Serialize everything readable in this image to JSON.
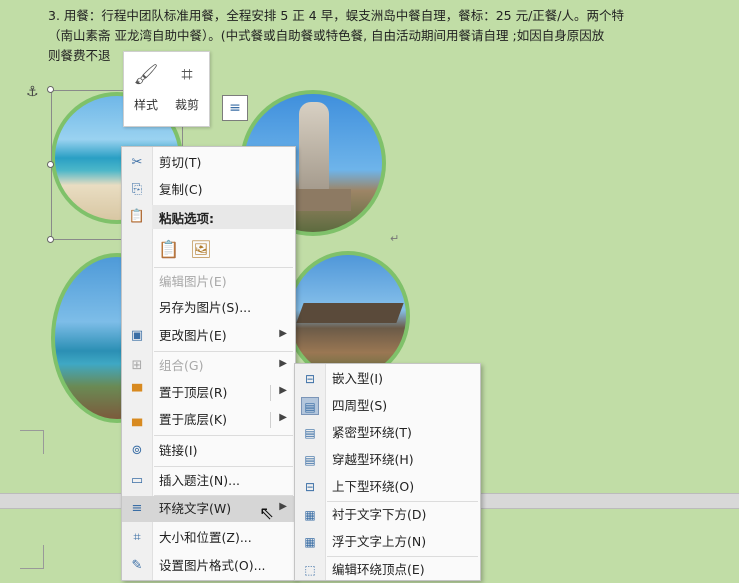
{
  "document": {
    "lines": [
      "3. 用餐：行程中团队标准用餐，全程安排 5 正 4 早，蜈支洲岛中餐自理，餐标：25 元/正餐/人。两个特",
      "（南山素斋 亚龙湾自助中餐）。(中式餐或自助餐或特色餐, 自由活动期间用餐请自理 ;如因自身原因放",
      "则餐费不退"
    ],
    "anchor_symbol": "⚓",
    "para_mark": "↵"
  },
  "mini_toolbar": {
    "style_label": "样式",
    "crop_label": "裁剪"
  },
  "context_menu": {
    "items": [
      {
        "label": "剪切(T)",
        "icon": "scissors-icon"
      },
      {
        "label": "复制(C)",
        "icon": "copy-icon"
      },
      {
        "label": "粘贴选项:",
        "icon": "paste-icon"
      },
      {
        "label": "编辑图片(E)",
        "icon": "",
        "disabled": true
      },
      {
        "label": "另存为图片(S)...",
        "icon": ""
      },
      {
        "label": "更改图片(E)",
        "icon": "change-picture-icon",
        "submenu": true
      },
      {
        "label": "组合(G)",
        "icon": "group-icon",
        "disabled": true,
        "submenu": true
      },
      {
        "label": "置于顶层(R)",
        "icon": "bring-to-front-icon",
        "submenu": true
      },
      {
        "label": "置于底层(K)",
        "icon": "send-to-back-icon",
        "submenu": true
      },
      {
        "label": "链接(I)",
        "icon": "link-icon"
      },
      {
        "label": "插入题注(N)...",
        "icon": "caption-icon"
      },
      {
        "label": "环绕文字(W)",
        "icon": "wrap-text-icon",
        "submenu": true,
        "highlighted": true
      },
      {
        "label": "大小和位置(Z)...",
        "icon": "size-position-icon"
      },
      {
        "label": "设置图片格式(O)...",
        "icon": "format-picture-icon"
      }
    ]
  },
  "wrap_submenu": {
    "items": [
      {
        "label": "嵌入型(I)",
        "icon": "inline-icon"
      },
      {
        "label": "四周型(S)",
        "icon": "square-wrap-icon",
        "selected": true
      },
      {
        "label": "紧密型环绕(T)",
        "icon": "tight-wrap-icon"
      },
      {
        "label": "穿越型环绕(H)",
        "icon": "through-wrap-icon"
      },
      {
        "label": "上下型环绕(O)",
        "icon": "top-bottom-icon"
      },
      {
        "label": "衬于文字下方(D)",
        "icon": "behind-text-icon"
      },
      {
        "label": "浮于文字上方(N)",
        "icon": "in-front-icon"
      },
      {
        "label": "编辑环绕顶点(E)",
        "icon": "edit-wrap-points-icon"
      }
    ]
  }
}
